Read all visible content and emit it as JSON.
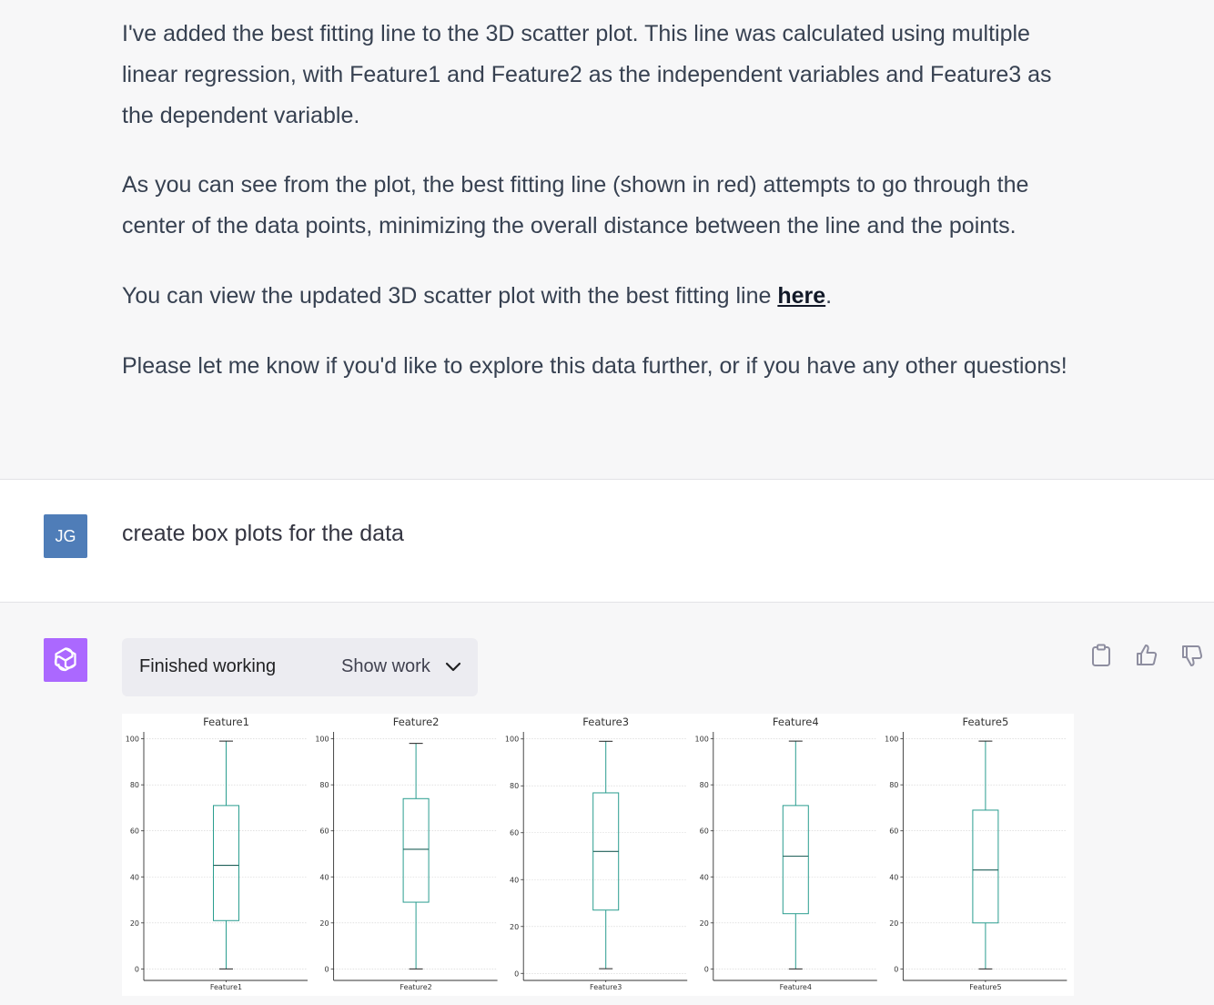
{
  "previous_message": {
    "paragraphs": [
      "I've added the best fitting line to the 3D scatter plot. This line was calculated using multiple linear regression, with Feature1 and Feature2 as the independent variables and Feature3 as the dependent variable.",
      "As you can see from the plot, the best fitting line (shown in red) attempts to go through the center of the data points, minimizing the overall distance between the line and the points."
    ],
    "link_prefix": "You can view the updated 3D scatter plot with the best fitting line ",
    "link_text": "here",
    "link_suffix": ".",
    "closing": "Please let me know if you'd like to explore this data further, or if you have any other questions!"
  },
  "user_message": {
    "avatar_initials": "JG",
    "text": "create box plots for the data"
  },
  "assistant_message": {
    "avatar_icon": "openai-logo-icon",
    "work_status": "Finished working",
    "show_work_label": "Show work",
    "actions": [
      "clipboard-icon",
      "thumbs-up-icon",
      "thumbs-down-icon"
    ]
  },
  "colors": {
    "avatar_user": "#4f7db8",
    "avatar_ai": "#ab68ff",
    "box_stroke": "#2a9d8f",
    "median": "#1f5f58"
  },
  "chart_data": [
    {
      "type": "box",
      "title": "Feature1",
      "xlabel": "Feature1",
      "ylim": [
        -5,
        103
      ],
      "yticks": [
        0,
        20,
        40,
        60,
        80,
        100
      ],
      "stats": {
        "min": 0,
        "q1": 21,
        "median": 45,
        "q3": 71,
        "max": 99
      },
      "grid": true
    },
    {
      "type": "box",
      "title": "Feature2",
      "xlabel": "Feature2",
      "ylim": [
        -5,
        103
      ],
      "yticks": [
        0,
        20,
        40,
        60,
        80,
        100
      ],
      "stats": {
        "min": 0,
        "q1": 29,
        "median": 52,
        "q3": 74,
        "max": 98
      },
      "grid": true
    },
    {
      "type": "box",
      "title": "Feature3",
      "xlabel": "Feature3",
      "ylim": [
        -3,
        103
      ],
      "yticks": [
        0,
        20,
        40,
        60,
        80,
        100
      ],
      "stats": {
        "min": 2,
        "q1": 27,
        "median": 52,
        "q3": 77,
        "max": 99
      },
      "grid": true
    },
    {
      "type": "box",
      "title": "Feature4",
      "xlabel": "Feature4",
      "ylim": [
        -5,
        103
      ],
      "yticks": [
        0,
        20,
        40,
        60,
        80,
        100
      ],
      "stats": {
        "min": 0,
        "q1": 24,
        "median": 49,
        "q3": 71,
        "max": 99
      },
      "grid": true
    },
    {
      "type": "box",
      "title": "Feature5",
      "xlabel": "Feature5",
      "ylim": [
        -5,
        103
      ],
      "yticks": [
        0,
        20,
        40,
        60,
        80,
        100
      ],
      "stats": {
        "min": 0,
        "q1": 20,
        "median": 43,
        "q3": 69,
        "max": 99
      },
      "grid": true
    }
  ]
}
